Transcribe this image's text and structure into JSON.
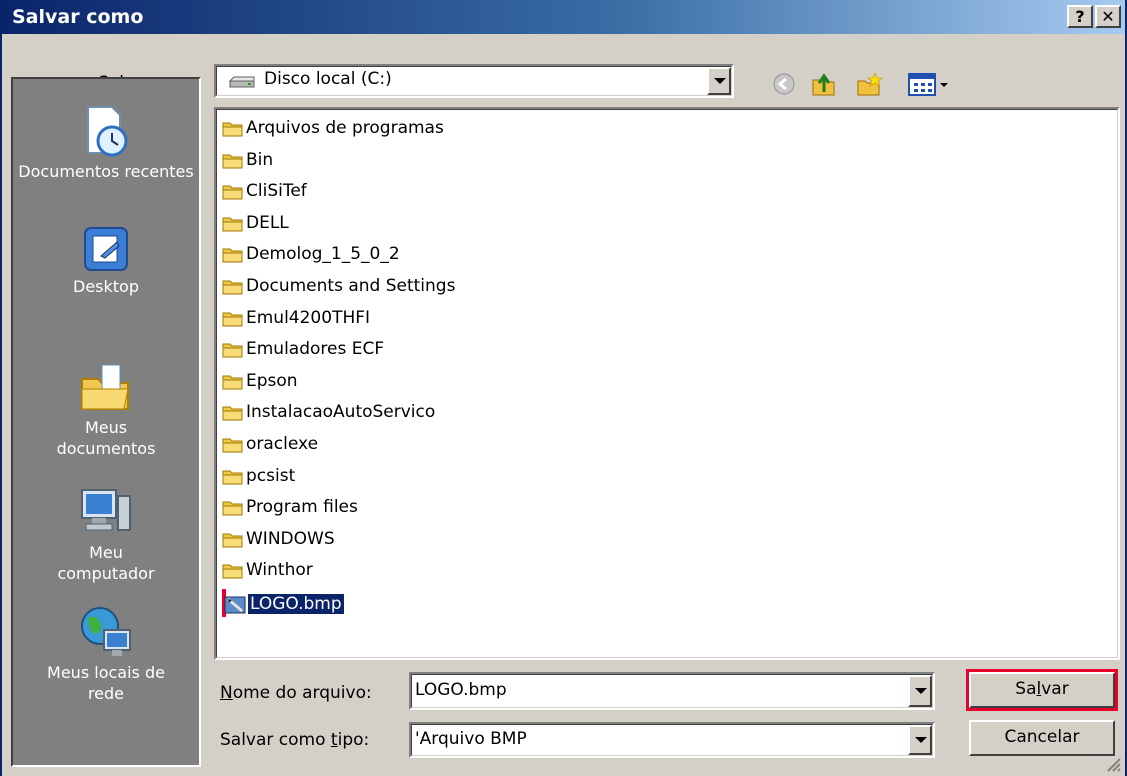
{
  "window": {
    "title": "Salvar como",
    "help_label": "?",
    "close_label": "✕"
  },
  "save_in": {
    "label_mnemonic": "S",
    "label_rest": "alvar em:",
    "value": "Disco local (C:)"
  },
  "toolbar": {
    "icons": [
      "back-icon",
      "up-folder-icon",
      "new-folder-icon",
      "views-menu-icon"
    ]
  },
  "places": [
    {
      "label": "Documentos recentes",
      "icon": "recent-documents-icon"
    },
    {
      "label": "Desktop",
      "icon": "desktop-icon"
    },
    {
      "label": "Meus documentos",
      "icon": "my-documents-icon"
    },
    {
      "label": "Meu computador",
      "icon": "my-computer-icon"
    },
    {
      "label": "Meus locais de rede",
      "icon": "network-places-icon"
    }
  ],
  "files": [
    {
      "name": "Arquivos de programas",
      "type": "folder"
    },
    {
      "name": "Bin",
      "type": "folder"
    },
    {
      "name": "CliSiTef",
      "type": "folder"
    },
    {
      "name": "DELL",
      "type": "folder"
    },
    {
      "name": "Demolog_1_5_0_2",
      "type": "folder"
    },
    {
      "name": "Documents and Settings",
      "type": "folder"
    },
    {
      "name": "Emul4200THFI",
      "type": "folder"
    },
    {
      "name": "Emuladores ECF",
      "type": "folder"
    },
    {
      "name": "Epson",
      "type": "folder"
    },
    {
      "name": "InstalacaoAutoServico",
      "type": "folder"
    },
    {
      "name": "oraclexe",
      "type": "folder"
    },
    {
      "name": "pcsist",
      "type": "folder"
    },
    {
      "name": "Program files",
      "type": "folder"
    },
    {
      "name": "WINDOWS",
      "type": "folder"
    },
    {
      "name": "Winthor",
      "type": "folder"
    },
    {
      "name": "LOGO.bmp",
      "type": "bmp",
      "selected": true
    }
  ],
  "filename": {
    "label_mnemonic": "N",
    "label_rest": "ome do arquivo:",
    "value": "LOGO.bmp"
  },
  "filetype": {
    "label_pre": "Salvar como ",
    "label_mnemonic": "t",
    "label_rest": "ipo:",
    "value": "'Arquivo BMP"
  },
  "buttons": {
    "save_pre": "Sa",
    "save_mnemonic": "l",
    "save_rest": "var",
    "cancel": "Cancelar"
  },
  "colors": {
    "title_bar": "#0a246a",
    "dialog_face": "#d4d0c8",
    "selection": "#0a246a",
    "highlight_frame": "#e8002c"
  }
}
